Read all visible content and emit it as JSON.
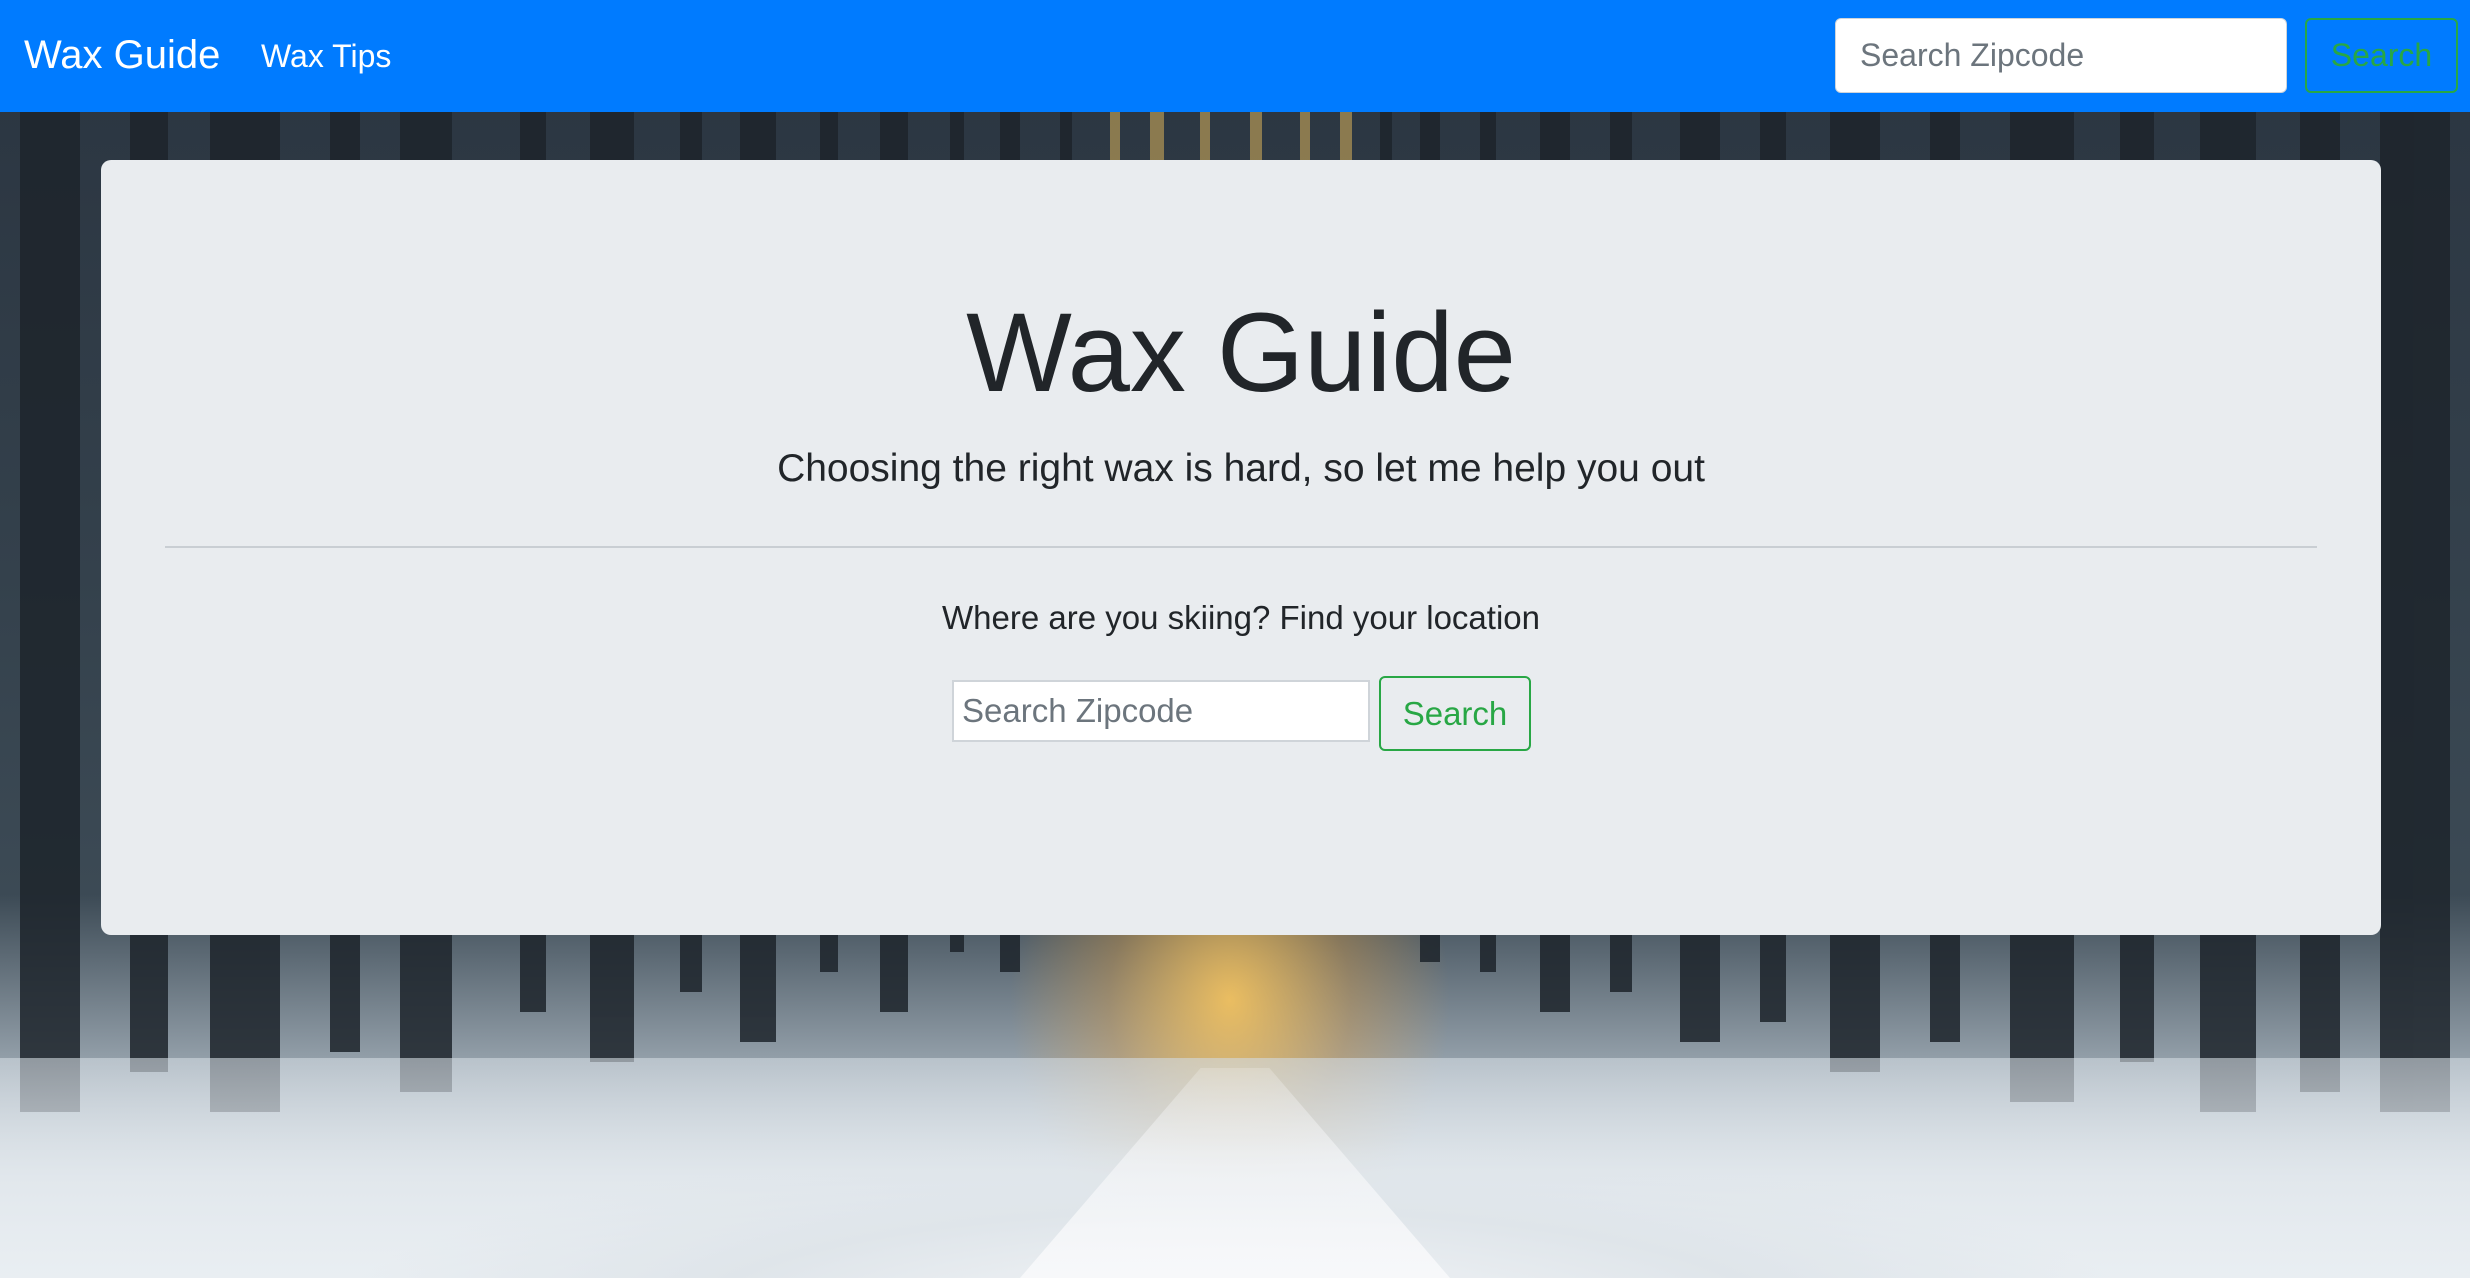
{
  "navbar": {
    "brand": "Wax Guide",
    "links": [
      {
        "label": "Wax Tips"
      }
    ],
    "search": {
      "placeholder": "Search Zipcode",
      "value": "",
      "button_label": "Search"
    }
  },
  "hero": {
    "title": "Wax Guide",
    "lead": "Choosing the right wax is hard, so let me help you out",
    "prompt": "Where are you skiing? Find your location",
    "search": {
      "placeholder": "Search Zipcode",
      "value": "",
      "button_label": "Search"
    }
  },
  "colors": {
    "navbar_bg": "#007bff",
    "jumbotron_bg": "#e9ecef",
    "button_outline_success": "#28a745",
    "text_dark": "#212529"
  }
}
